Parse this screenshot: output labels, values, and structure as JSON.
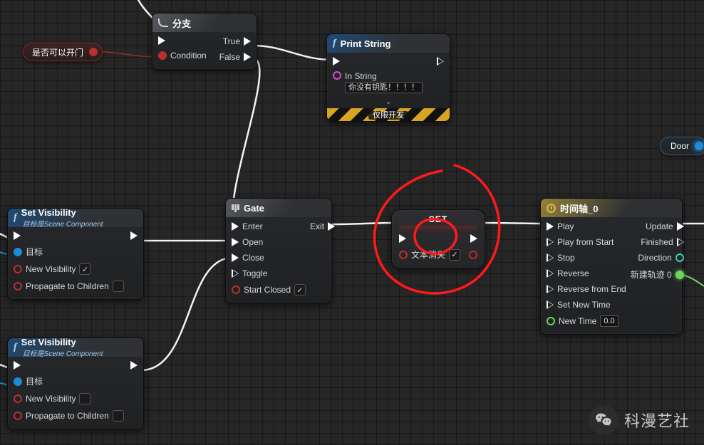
{
  "branch": {
    "title": "分支",
    "cond_label": "Condition",
    "true_label": "True",
    "false_label": "False"
  },
  "var_can_open": {
    "label": "是否可以开门"
  },
  "print": {
    "title": "Print String",
    "in_string_label": "In String",
    "in_string_value": "你没有钥匙！！！！",
    "dev_only": "仅限开发"
  },
  "set_vis_a": {
    "title": "Set Visibility",
    "subtitle": "目标是Scene Component",
    "target_label": "目标",
    "newvis_label": "New Visibility",
    "propagate_label": "Propagate to Children"
  },
  "set_vis_b": {
    "title": "Set Visibility",
    "subtitle": "目标是Scene Component",
    "target_label": "目标",
    "newvis_label": "New Visibility",
    "propagate_label": "Propagate to Children"
  },
  "gate": {
    "title": "Gate",
    "enter": "Enter",
    "open": "Open",
    "close": "Close",
    "toggle": "Toggle",
    "start_closed": "Start Closed",
    "exit": "Exit"
  },
  "set": {
    "title": "SET",
    "var_label": "文本消失"
  },
  "door_var": {
    "label": "Door"
  },
  "timeline": {
    "title": "时间轴_0",
    "play": "Play",
    "play_start": "Play from Start",
    "stop": "Stop",
    "reverse": "Reverse",
    "reverse_end": "Reverse from End",
    "set_time": "Set New Time",
    "new_time_label": "New Time",
    "new_time_value": "0.0",
    "update": "Update",
    "finished": "Finished",
    "direction": "Direction",
    "new_track": "新建轨迹 0"
  },
  "watermark": "科漫艺社"
}
